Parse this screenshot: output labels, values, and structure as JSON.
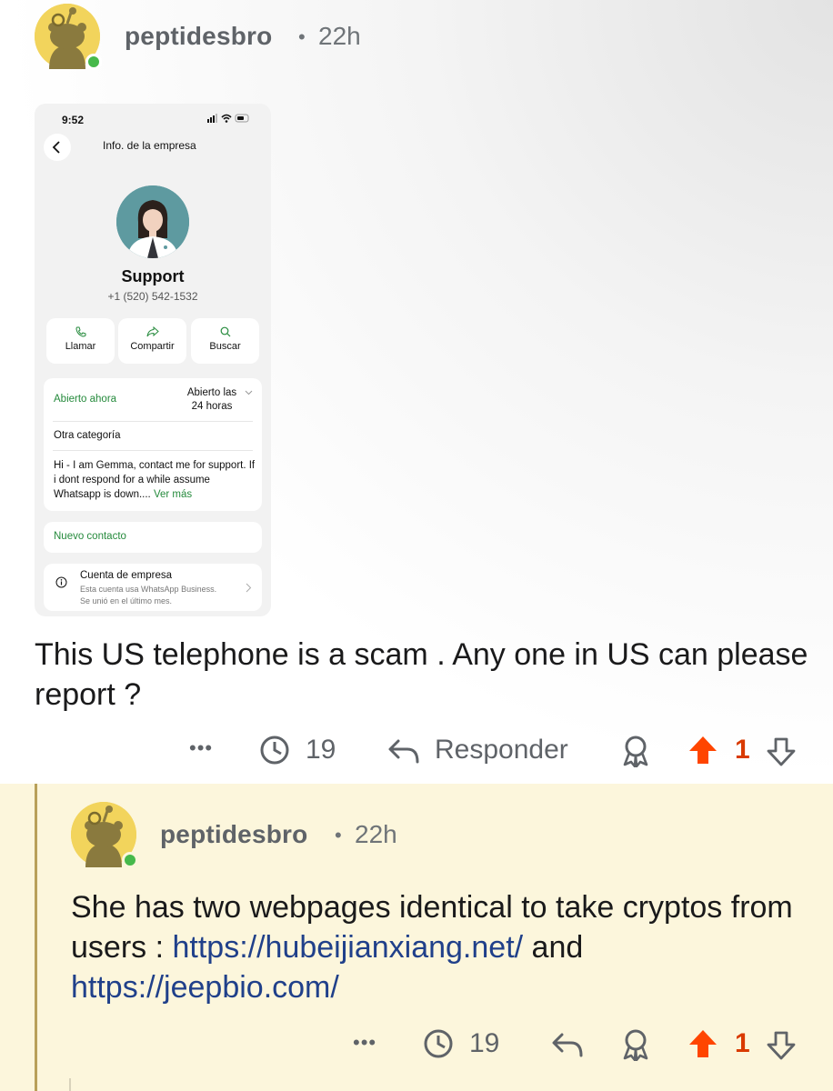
{
  "post": {
    "username": "peptidesbro",
    "separator": "•",
    "time": "22h",
    "body": "This US telephone is a scam . Any one in US can please report ?",
    "actions": {
      "more": "•••",
      "award_count": "19",
      "reply_label": "Responder",
      "vote_count": "1"
    }
  },
  "screenshot": {
    "status_time": "9:52",
    "nav_title": "Info. de la empresa",
    "contact_name": "Support",
    "contact_phone": "+1 (520) 542-1532",
    "actions": [
      "Llamar",
      "Compartir",
      "Buscar"
    ],
    "hours_status": "Abierto ahora",
    "hours_value_line1": "Abierto las",
    "hours_value_line2": "24 horas",
    "category": "Otra categoría",
    "description": "Hi - I am Gemma, contact me for support. If i dont respond for a while assume Whatsapp is down....",
    "see_more": "Ver más",
    "new_contact": "Nuevo contacto",
    "business_title": "Cuenta de empresa",
    "business_sub1": "Esta cuenta usa WhatsApp Business.",
    "business_sub2": "Se unió en el último mes."
  },
  "reply": {
    "username": "peptidesbro",
    "separator": "•",
    "time": "22h",
    "text_before": "She has two webpages identical to take cryptos from users : ",
    "link1": "https://hubeijianxiang.net/",
    "text_between": " and ",
    "link2": "https://jeepbio.com/",
    "actions": {
      "more": "•••",
      "award_count": "19",
      "vote_count": "1"
    }
  },
  "colors": {
    "upvote": "#ff4500",
    "reply_bg": "#fcf6dc",
    "link": "#20408a",
    "online": "#46b94b"
  }
}
